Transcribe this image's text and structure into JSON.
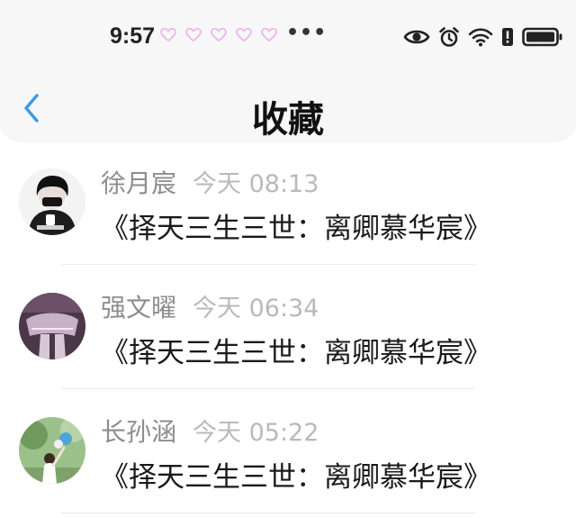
{
  "status_bar": {
    "time": "9:57",
    "notification_icons": [
      "heart-icon",
      "heart-icon",
      "heart-icon",
      "heart-icon",
      "heart-icon"
    ],
    "more_indicator": "•••",
    "system_icons": [
      "eye-icon",
      "alarm-icon",
      "wifi-icon",
      "battery-alert-icon",
      "battery-icon"
    ]
  },
  "nav": {
    "title": "收藏",
    "back_icon": "chevron-left-icon"
  },
  "colors": {
    "accent": "#3a9be8",
    "heart": "#e9b7ea",
    "name_text": "#8d8d8d",
    "time_text": "#b9b9b9"
  },
  "favorites": [
    {
      "user": "徐月宸",
      "time": "今天 08:13",
      "content": "《择天三生三世：离卿慕华宸》"
    },
    {
      "user": "强文曜",
      "time": "今天 06:34",
      "content": "《择天三生三世：离卿慕华宸》"
    },
    {
      "user": "长孙涵",
      "time": "今天 05:22",
      "content": "《择天三生三世：离卿慕华宸》"
    }
  ]
}
